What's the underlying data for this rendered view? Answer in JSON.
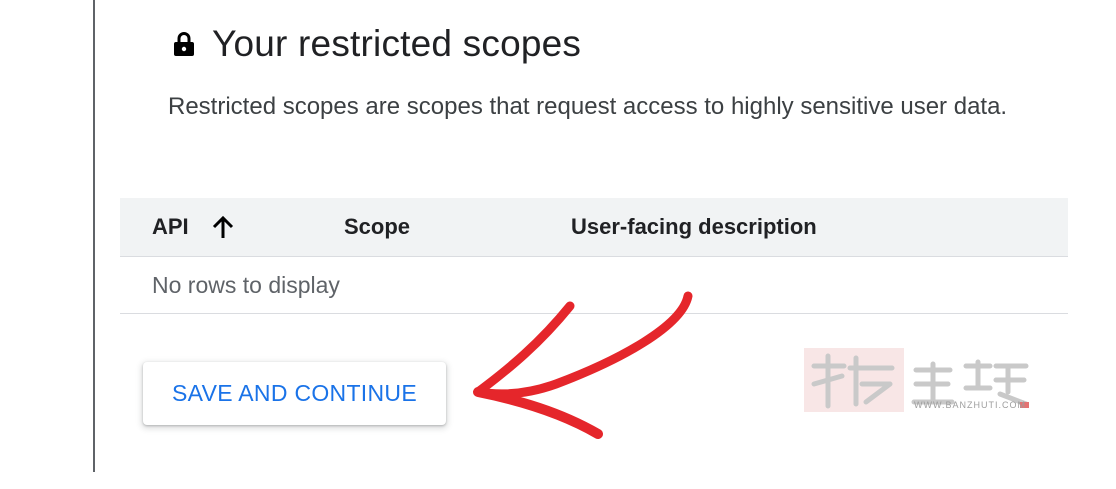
{
  "section": {
    "title": "Your restricted scopes",
    "description": "Restricted scopes are scopes that request access to highly sensitive user data."
  },
  "table": {
    "columns": [
      "API",
      "Scope",
      "User-facing description"
    ],
    "empty_message": "No rows to display"
  },
  "actions": {
    "save_label": "SAVE AND CONTINUE"
  },
  "watermark": {
    "url": "WWW.BANZHUTI.COM"
  },
  "colors": {
    "accent": "#1a73e8",
    "annotation": "#e5262b",
    "header_bg": "#f1f3f4"
  },
  "icons": [
    "lock-icon",
    "arrow-up-icon",
    "hand-drawn-arrow"
  ]
}
